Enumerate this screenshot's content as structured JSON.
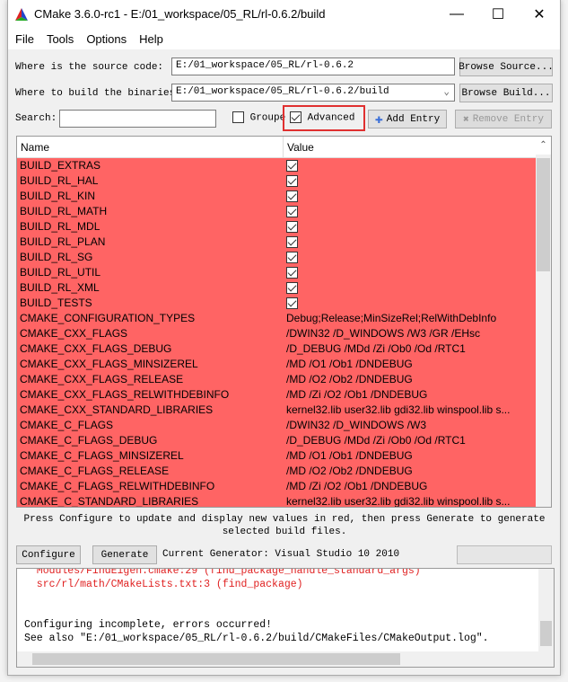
{
  "window": {
    "title": "CMake 3.6.0-rc1 - E:/01_workspace/05_RL/rl-0.6.2/build"
  },
  "menu": [
    "File",
    "Tools",
    "Options",
    "Help"
  ],
  "source": {
    "label": "Where is the source code:",
    "value": "E:/01_workspace/05_RL/rl-0.6.2",
    "button": "Browse Source..."
  },
  "build": {
    "label": "Where to build the binaries:",
    "value": "E:/01_workspace/05_RL/rl-0.6.2/build",
    "button": "Browse Build..."
  },
  "search": {
    "label": "Search:",
    "value": ""
  },
  "grouped": {
    "label": "Grouped",
    "checked": false
  },
  "advanced": {
    "label": "Advanced",
    "checked": true,
    "highlight": "#e03030"
  },
  "add_entry": "Add Entry",
  "remove_entry": "Remove Entry",
  "table": {
    "columns": [
      "Name",
      "Value"
    ],
    "row_color": "#ff6464",
    "rows": [
      [
        "BUILD_EXTRAS",
        true
      ],
      [
        "BUILD_RL_HAL",
        true
      ],
      [
        "BUILD_RL_KIN",
        true
      ],
      [
        "BUILD_RL_MATH",
        true
      ],
      [
        "BUILD_RL_MDL",
        true
      ],
      [
        "BUILD_RL_PLAN",
        true
      ],
      [
        "BUILD_RL_SG",
        true
      ],
      [
        "BUILD_RL_UTIL",
        true
      ],
      [
        "BUILD_RL_XML",
        true
      ],
      [
        "BUILD_TESTS",
        true
      ],
      [
        "CMAKE_CONFIGURATION_TYPES",
        "Debug;Release;MinSizeRel;RelWithDebInfo"
      ],
      [
        "CMAKE_CXX_FLAGS",
        " /DWIN32 /D_WINDOWS /W3 /GR /EHsc"
      ],
      [
        "CMAKE_CXX_FLAGS_DEBUG",
        "/D_DEBUG /MDd /Zi /Ob0 /Od /RTC1"
      ],
      [
        "CMAKE_CXX_FLAGS_MINSIZEREL",
        "/MD /O1 /Ob1 /DNDEBUG"
      ],
      [
        "CMAKE_CXX_FLAGS_RELEASE",
        "/MD /O2 /Ob2 /DNDEBUG"
      ],
      [
        "CMAKE_CXX_FLAGS_RELWITHDEBINFO",
        "/MD /Zi /O2 /Ob1 /DNDEBUG"
      ],
      [
        "CMAKE_CXX_STANDARD_LIBRARIES",
        "kernel32.lib user32.lib gdi32.lib winspool.lib s..."
      ],
      [
        "CMAKE_C_FLAGS",
        " /DWIN32 /D_WINDOWS /W3"
      ],
      [
        "CMAKE_C_FLAGS_DEBUG",
        "/D_DEBUG /MDd /Zi /Ob0 /Od /RTC1"
      ],
      [
        "CMAKE_C_FLAGS_MINSIZEREL",
        "/MD /O1 /Ob1 /DNDEBUG"
      ],
      [
        "CMAKE_C_FLAGS_RELEASE",
        "/MD /O2 /Ob2 /DNDEBUG"
      ],
      [
        "CMAKE_C_FLAGS_RELWITHDEBINFO",
        "/MD /Zi /O2 /Ob1 /DNDEBUG"
      ],
      [
        "CMAKE_C_STANDARD_LIBRARIES",
        "kernel32.lib user32.lib gdi32.lib winspool.lib s..."
      ]
    ]
  },
  "hint": "Press Configure to update and display new values in red, then press Generate to generate selected build files.",
  "configure": "Configure",
  "generate": "Generate",
  "generator": "Current Generator: Visual Studio 10 2010",
  "log": [
    {
      "text": "  Modules/FindEigen.cmake:29 (find_package_handle_standard_args)",
      "red": true
    },
    {
      "text": "  src/rl/math/CMakeLists.txt:3 (find_package)",
      "red": true
    },
    {
      "text": "",
      "red": false
    },
    {
      "text": "",
      "red": false
    },
    {
      "text": "Configuring incomplete, errors occurred!",
      "red": false
    },
    {
      "text": "See also \"E:/01_workspace/05_RL/rl-0.6.2/build/CMakeFiles/CMakeOutput.log\".",
      "red": false
    }
  ]
}
